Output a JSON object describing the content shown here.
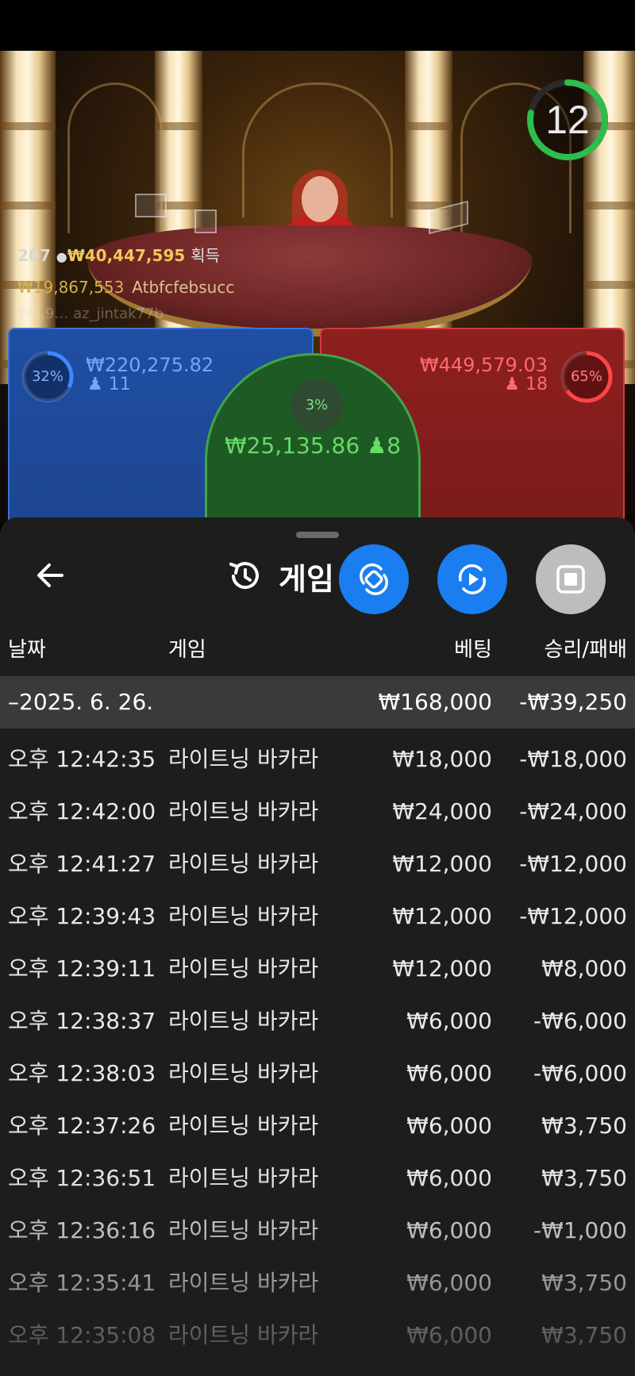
{
  "stream": {
    "timer": "12",
    "players_count": "207",
    "total_won": "₩40,447,595",
    "won_label": "획득",
    "top_winner_amount": "₩19,867,553",
    "top_winner_name": "Atbfcfebsucc",
    "faded_winner": "₩8,9… az_jintak77b",
    "colors": {
      "player": "#1f4ea3",
      "banker": "#8e1f1f",
      "tie": "#1e5a23",
      "timer_ring": "#2ebd4b"
    }
  },
  "bets": {
    "player": {
      "percent": "32%",
      "percent_value": 0.32,
      "amount": "₩220,275.82",
      "count": "11"
    },
    "banker": {
      "percent": "65%",
      "percent_value": 0.65,
      "amount": "₩449,579.03",
      "count": "18"
    },
    "tie": {
      "percent": "3%",
      "percent_value": 0.03,
      "amount": "₩25,135.86",
      "count": "8"
    }
  },
  "history": {
    "title": "게임",
    "columns": {
      "date": "날짜",
      "game": "게임",
      "bet": "베팅",
      "result": "승리/패배"
    },
    "summary": {
      "date": "–2025. 6. 26.",
      "bet": "₩168,000",
      "result": "-₩39,250"
    },
    "rows": [
      {
        "time": "오후 12:42:35",
        "game": "라이트닝 바카라",
        "bet": "₩18,000",
        "result": "-₩18,000"
      },
      {
        "time": "오후 12:42:00",
        "game": "라이트닝 바카라",
        "bet": "₩24,000",
        "result": "-₩24,000"
      },
      {
        "time": "오후 12:41:27",
        "game": "라이트닝 바카라",
        "bet": "₩12,000",
        "result": "-₩12,000"
      },
      {
        "time": "오후 12:39:43",
        "game": "라이트닝 바카라",
        "bet": "₩12,000",
        "result": "-₩12,000"
      },
      {
        "time": "오후 12:39:11",
        "game": "라이트닝 바카라",
        "bet": "₩12,000",
        "result": "₩8,000"
      },
      {
        "time": "오후 12:38:37",
        "game": "라이트닝 바카라",
        "bet": "₩6,000",
        "result": "-₩6,000"
      },
      {
        "time": "오후 12:38:03",
        "game": "라이트닝 바카라",
        "bet": "₩6,000",
        "result": "-₩6,000"
      },
      {
        "time": "오후 12:37:26",
        "game": "라이트닝 바카라",
        "bet": "₩6,000",
        "result": "₩3,750"
      },
      {
        "time": "오후 12:36:51",
        "game": "라이트닝 바카라",
        "bet": "₩6,000",
        "result": "₩3,750"
      },
      {
        "time": "오후 12:36:16",
        "game": "라이트닝 바카라",
        "bet": "₩6,000",
        "result": "-₩1,000"
      },
      {
        "time": "오후 12:35:41",
        "game": "라이트닝 바카라",
        "bet": "₩6,000",
        "result": "₩3,750"
      },
      {
        "time": "오후 12:35:08",
        "game": "라이트닝 바카라",
        "bet": "₩6,000",
        "result": "₩3,750"
      }
    ]
  },
  "icons": {
    "back": "arrow-left-icon",
    "history": "history-clock-icon",
    "fab1": "swap-rotate-icon",
    "fab2": "rotate-play-icon",
    "fab3": "stop-icon"
  }
}
